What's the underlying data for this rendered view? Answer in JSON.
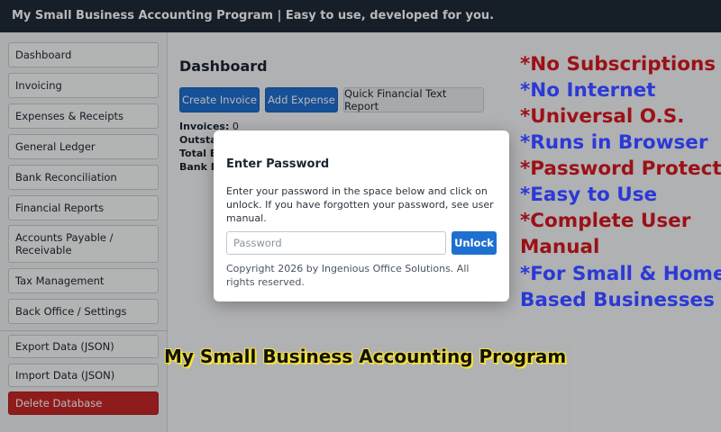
{
  "topbar": {
    "title": "My Small Business Accounting Program | Easy to use, developed for you."
  },
  "sidebar": {
    "items": [
      {
        "label": "Dashboard"
      },
      {
        "label": "Invoicing"
      },
      {
        "label": "Expenses & Receipts"
      },
      {
        "label": "General Ledger"
      },
      {
        "label": "Bank Reconciliation"
      },
      {
        "label": "Financial Reports"
      },
      {
        "label": "Accounts Payable / Receivable"
      },
      {
        "label": "Tax Management"
      },
      {
        "label": "Back Office / Settings"
      }
    ],
    "data_actions": [
      {
        "label": "Export Data (JSON)"
      },
      {
        "label": "Import Data (JSON)"
      },
      {
        "label": "Delete Database"
      }
    ]
  },
  "main": {
    "title": "Dashboard",
    "buttons": {
      "create_invoice": "Create Invoice",
      "add_expense": "Add Expense",
      "quick_report": "Quick Financial Text Report"
    },
    "stats": {
      "invoices_label": "Invoices:",
      "invoices_value": "0",
      "outstanding_label": "Outstan",
      "total_label": "Total Ex",
      "bank_label": "Bank Ba"
    }
  },
  "modal": {
    "title": "Enter Password",
    "text": "Enter your password in the space below and click on unlock. If you have forgotten your password, see user manual.",
    "password_placeholder": "Password",
    "unlock_label": "Unlock",
    "copyright": "Copyright 2026 by Ingenious Office Solutions. All rights reserved."
  },
  "promo": [
    {
      "text": "*No Subscriptions",
      "color": "#9b1116"
    },
    {
      "text": "*No Internet",
      "color": "#2b39d6"
    },
    {
      "text": "*Universal O.S.",
      "color": "#9b1116"
    },
    {
      "text": "*Runs in Browser",
      "color": "#2b39d6"
    },
    {
      "text": "*Password Protected",
      "color": "#9b1116"
    },
    {
      "text": "*Easy to Use",
      "color": "#2b39d6"
    },
    {
      "text": "*Complete User",
      "color": "#9b1116"
    },
    {
      "text": "Manual",
      "color": "#9b1116"
    },
    {
      "text": "*For Small & Home",
      "color": "#2b39d6"
    },
    {
      "text": "Based Businesses",
      "color": "#2b39d6"
    }
  ],
  "banner": {
    "text": "My Small Business Accounting Program"
  },
  "colors": {
    "accent": "#1f6fd1",
    "danger": "#c62828",
    "topbar": "#1f2a37"
  }
}
